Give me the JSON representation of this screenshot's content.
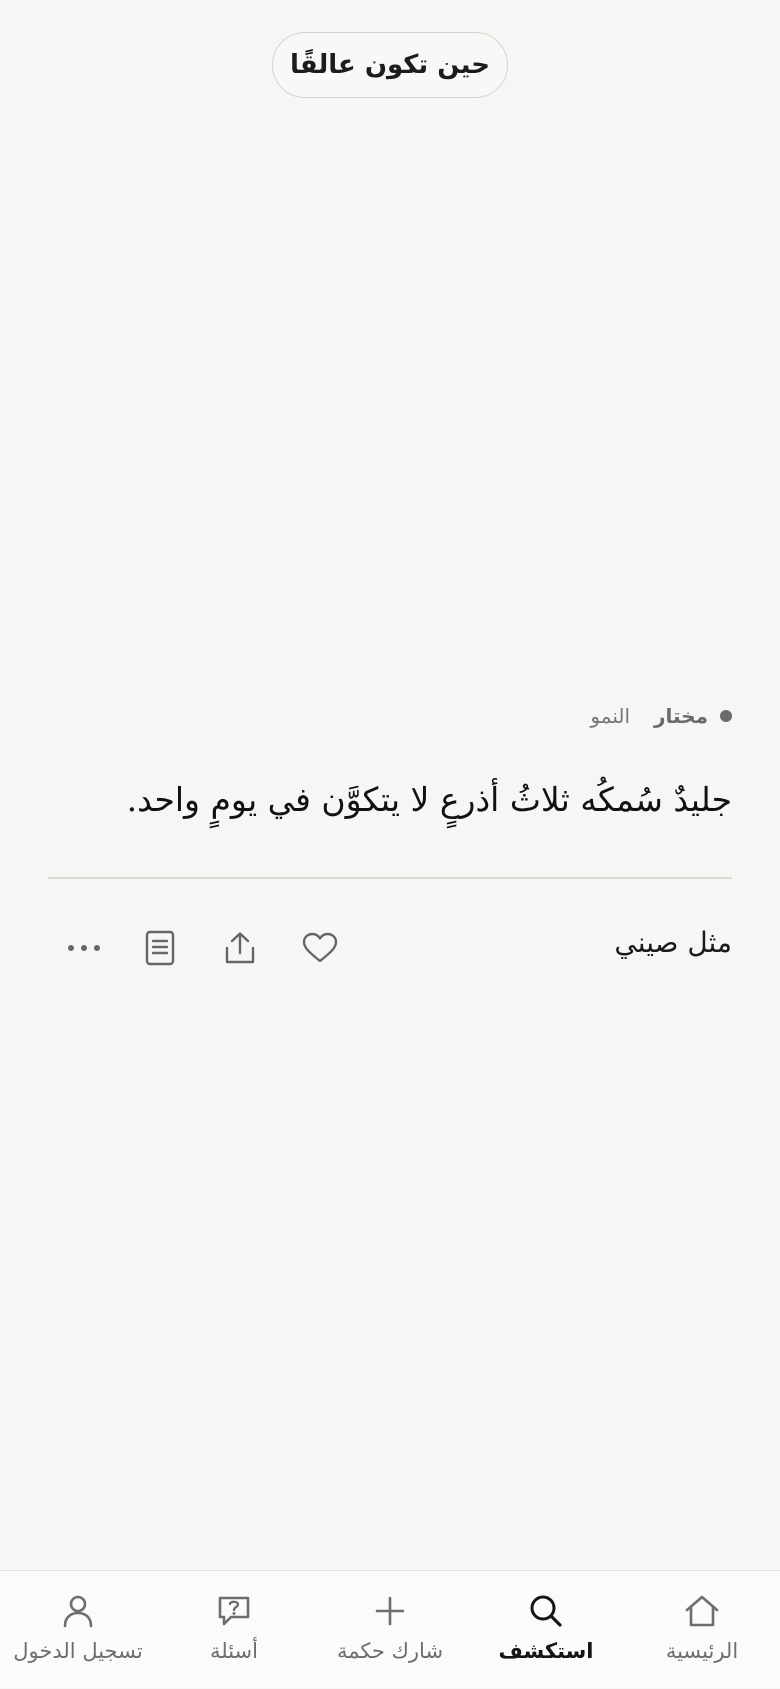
{
  "topic_pill": {
    "label": "حين تكون عالقًا"
  },
  "card": {
    "tag": "مختار",
    "category": "النمو",
    "quote": "جليدٌ سُمكُه ثلاثُ أذرعٍ لا يتكوَّن في يومٍ واحد.",
    "source": "مثل صيني",
    "actions": {
      "like_icon": "heart-icon",
      "share_icon": "share-icon",
      "details_icon": "document-icon",
      "more_icon": "more-horizontal-icon"
    }
  },
  "bottom_nav": {
    "items": [
      {
        "label": "الرئيسية",
        "icon": "home-icon",
        "active": false
      },
      {
        "label": "استكشف",
        "icon": "search-icon",
        "active": true
      },
      {
        "label": "شارك حكمة",
        "icon": "plus-icon",
        "active": false
      },
      {
        "label": "أسئلة",
        "icon": "question-bubble-icon",
        "active": false
      },
      {
        "label": "تسجيل الدخول",
        "icon": "user-icon",
        "active": false
      }
    ]
  },
  "colors": {
    "background": "#f7f6f4",
    "text": "#1a1a1a",
    "muted": "#6e6e6e",
    "divider": "#dcdad7"
  }
}
